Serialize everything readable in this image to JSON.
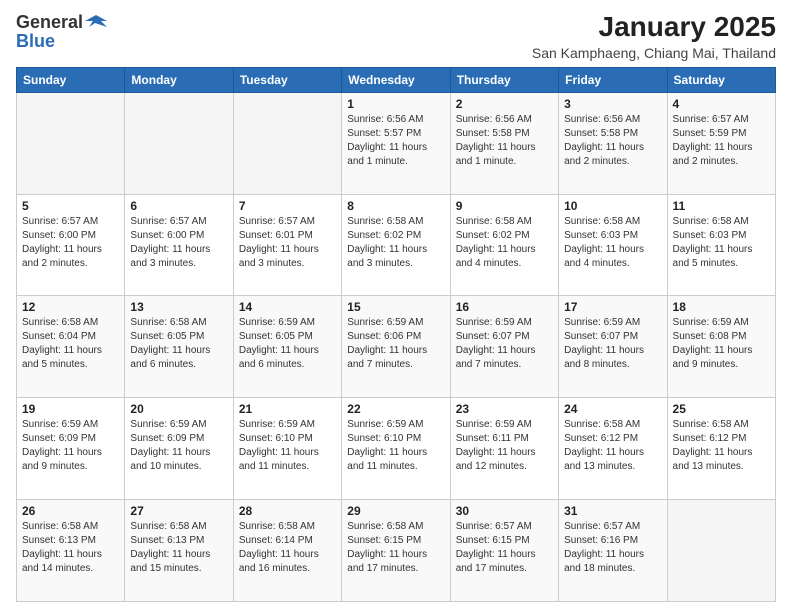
{
  "logo": {
    "general": "General",
    "blue": "Blue"
  },
  "header": {
    "month_title": "January 2025",
    "location": "San Kamphaeng, Chiang Mai, Thailand"
  },
  "weekdays": [
    "Sunday",
    "Monday",
    "Tuesday",
    "Wednesday",
    "Thursday",
    "Friday",
    "Saturday"
  ],
  "weeks": [
    [
      {
        "day": "",
        "sunrise": "",
        "sunset": "",
        "daylight": ""
      },
      {
        "day": "",
        "sunrise": "",
        "sunset": "",
        "daylight": ""
      },
      {
        "day": "",
        "sunrise": "",
        "sunset": "",
        "daylight": ""
      },
      {
        "day": "1",
        "sunrise": "Sunrise: 6:56 AM",
        "sunset": "Sunset: 5:57 PM",
        "daylight": "Daylight: 11 hours and 1 minute."
      },
      {
        "day": "2",
        "sunrise": "Sunrise: 6:56 AM",
        "sunset": "Sunset: 5:58 PM",
        "daylight": "Daylight: 11 hours and 1 minute."
      },
      {
        "day": "3",
        "sunrise": "Sunrise: 6:56 AM",
        "sunset": "Sunset: 5:58 PM",
        "daylight": "Daylight: 11 hours and 2 minutes."
      },
      {
        "day": "4",
        "sunrise": "Sunrise: 6:57 AM",
        "sunset": "Sunset: 5:59 PM",
        "daylight": "Daylight: 11 hours and 2 minutes."
      }
    ],
    [
      {
        "day": "5",
        "sunrise": "Sunrise: 6:57 AM",
        "sunset": "Sunset: 6:00 PM",
        "daylight": "Daylight: 11 hours and 2 minutes."
      },
      {
        "day": "6",
        "sunrise": "Sunrise: 6:57 AM",
        "sunset": "Sunset: 6:00 PM",
        "daylight": "Daylight: 11 hours and 3 minutes."
      },
      {
        "day": "7",
        "sunrise": "Sunrise: 6:57 AM",
        "sunset": "Sunset: 6:01 PM",
        "daylight": "Daylight: 11 hours and 3 minutes."
      },
      {
        "day": "8",
        "sunrise": "Sunrise: 6:58 AM",
        "sunset": "Sunset: 6:02 PM",
        "daylight": "Daylight: 11 hours and 3 minutes."
      },
      {
        "day": "9",
        "sunrise": "Sunrise: 6:58 AM",
        "sunset": "Sunset: 6:02 PM",
        "daylight": "Daylight: 11 hours and 4 minutes."
      },
      {
        "day": "10",
        "sunrise": "Sunrise: 6:58 AM",
        "sunset": "Sunset: 6:03 PM",
        "daylight": "Daylight: 11 hours and 4 minutes."
      },
      {
        "day": "11",
        "sunrise": "Sunrise: 6:58 AM",
        "sunset": "Sunset: 6:03 PM",
        "daylight": "Daylight: 11 hours and 5 minutes."
      }
    ],
    [
      {
        "day": "12",
        "sunrise": "Sunrise: 6:58 AM",
        "sunset": "Sunset: 6:04 PM",
        "daylight": "Daylight: 11 hours and 5 minutes."
      },
      {
        "day": "13",
        "sunrise": "Sunrise: 6:58 AM",
        "sunset": "Sunset: 6:05 PM",
        "daylight": "Daylight: 11 hours and 6 minutes."
      },
      {
        "day": "14",
        "sunrise": "Sunrise: 6:59 AM",
        "sunset": "Sunset: 6:05 PM",
        "daylight": "Daylight: 11 hours and 6 minutes."
      },
      {
        "day": "15",
        "sunrise": "Sunrise: 6:59 AM",
        "sunset": "Sunset: 6:06 PM",
        "daylight": "Daylight: 11 hours and 7 minutes."
      },
      {
        "day": "16",
        "sunrise": "Sunrise: 6:59 AM",
        "sunset": "Sunset: 6:07 PM",
        "daylight": "Daylight: 11 hours and 7 minutes."
      },
      {
        "day": "17",
        "sunrise": "Sunrise: 6:59 AM",
        "sunset": "Sunset: 6:07 PM",
        "daylight": "Daylight: 11 hours and 8 minutes."
      },
      {
        "day": "18",
        "sunrise": "Sunrise: 6:59 AM",
        "sunset": "Sunset: 6:08 PM",
        "daylight": "Daylight: 11 hours and 9 minutes."
      }
    ],
    [
      {
        "day": "19",
        "sunrise": "Sunrise: 6:59 AM",
        "sunset": "Sunset: 6:09 PM",
        "daylight": "Daylight: 11 hours and 9 minutes."
      },
      {
        "day": "20",
        "sunrise": "Sunrise: 6:59 AM",
        "sunset": "Sunset: 6:09 PM",
        "daylight": "Daylight: 11 hours and 10 minutes."
      },
      {
        "day": "21",
        "sunrise": "Sunrise: 6:59 AM",
        "sunset": "Sunset: 6:10 PM",
        "daylight": "Daylight: 11 hours and 11 minutes."
      },
      {
        "day": "22",
        "sunrise": "Sunrise: 6:59 AM",
        "sunset": "Sunset: 6:10 PM",
        "daylight": "Daylight: 11 hours and 11 minutes."
      },
      {
        "day": "23",
        "sunrise": "Sunrise: 6:59 AM",
        "sunset": "Sunset: 6:11 PM",
        "daylight": "Daylight: 11 hours and 12 minutes."
      },
      {
        "day": "24",
        "sunrise": "Sunrise: 6:58 AM",
        "sunset": "Sunset: 6:12 PM",
        "daylight": "Daylight: 11 hours and 13 minutes."
      },
      {
        "day": "25",
        "sunrise": "Sunrise: 6:58 AM",
        "sunset": "Sunset: 6:12 PM",
        "daylight": "Daylight: 11 hours and 13 minutes."
      }
    ],
    [
      {
        "day": "26",
        "sunrise": "Sunrise: 6:58 AM",
        "sunset": "Sunset: 6:13 PM",
        "daylight": "Daylight: 11 hours and 14 minutes."
      },
      {
        "day": "27",
        "sunrise": "Sunrise: 6:58 AM",
        "sunset": "Sunset: 6:13 PM",
        "daylight": "Daylight: 11 hours and 15 minutes."
      },
      {
        "day": "28",
        "sunrise": "Sunrise: 6:58 AM",
        "sunset": "Sunset: 6:14 PM",
        "daylight": "Daylight: 11 hours and 16 minutes."
      },
      {
        "day": "29",
        "sunrise": "Sunrise: 6:58 AM",
        "sunset": "Sunset: 6:15 PM",
        "daylight": "Daylight: 11 hours and 17 minutes."
      },
      {
        "day": "30",
        "sunrise": "Sunrise: 6:57 AM",
        "sunset": "Sunset: 6:15 PM",
        "daylight": "Daylight: 11 hours and 17 minutes."
      },
      {
        "day": "31",
        "sunrise": "Sunrise: 6:57 AM",
        "sunset": "Sunset: 6:16 PM",
        "daylight": "Daylight: 11 hours and 18 minutes."
      },
      {
        "day": "",
        "sunrise": "",
        "sunset": "",
        "daylight": ""
      }
    ]
  ]
}
